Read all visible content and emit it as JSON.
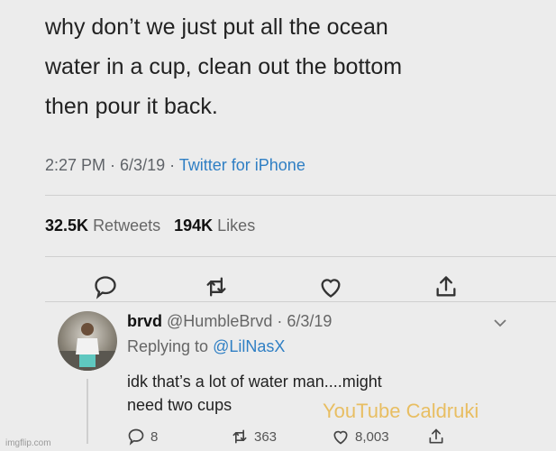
{
  "tweet": {
    "line1": "why don’t we just put all the ocean",
    "line2": "water in a cup, clean out the bottom",
    "line3": "then pour it back.",
    "time": "2:27 PM",
    "date": "6/3/19",
    "source": "Twitter for iPhone",
    "retweets_count": "32.5K",
    "retweets_label": "Retweets",
    "likes_count": "194K",
    "likes_label": "Likes"
  },
  "icons": {
    "reply": "reply-icon",
    "retweet": "retweet-icon",
    "like": "heart-icon",
    "share": "share-icon",
    "more": "chevron-down-icon"
  },
  "reply": {
    "name": "brvd",
    "handle": "@HumbleBrvd",
    "date": "6/3/19",
    "replying_label": "Replying to",
    "replying_handle": "@LilNasX",
    "line1": "idk that’s a lot of water man....might",
    "line2": "need two cups",
    "replies": "8",
    "retweets": "363",
    "likes": "8,003"
  },
  "watermark": "YouTube Caldruki",
  "imgflip": "imgflip.com",
  "colors": {
    "link": "#2f7fc4",
    "watermark": "#e8b64a",
    "background": "#ececec"
  }
}
